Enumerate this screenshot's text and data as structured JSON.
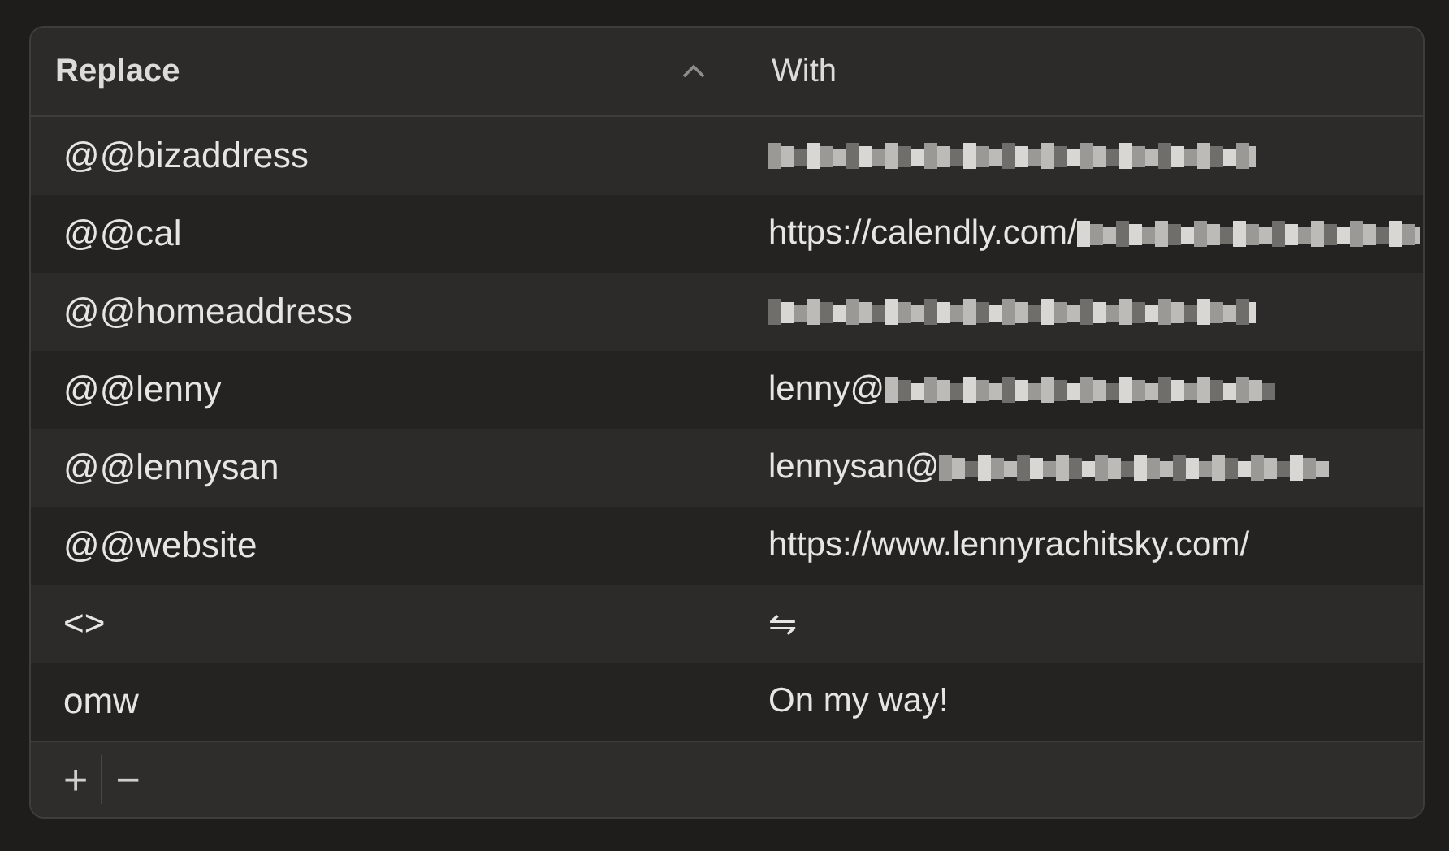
{
  "table": {
    "columns": [
      {
        "label": "Replace",
        "sorted": true
      },
      {
        "label": "With",
        "sorted": false
      }
    ],
    "rows": [
      {
        "replace": "@@bizaddress",
        "redacted": true
      },
      {
        "replace": "@@cal",
        "with": "https://calendly.com/",
        "redacted": true
      },
      {
        "replace": "@@homeaddress",
        "redacted": true
      },
      {
        "replace": "@@lenny",
        "with": "lenny@",
        "redacted": true
      },
      {
        "replace": "@@lennysan",
        "with": "lennysan@",
        "redacted": true
      },
      {
        "replace": "@@website",
        "with": "https://www.lennyrachitsky.com/",
        "redacted": false
      },
      {
        "replace": "<>",
        "with": "⇋",
        "redacted": false
      },
      {
        "replace": "omw",
        "with": "On my way!",
        "redacted": false
      }
    ]
  },
  "footer_buttons": [
    "+",
    "−"
  ]
}
